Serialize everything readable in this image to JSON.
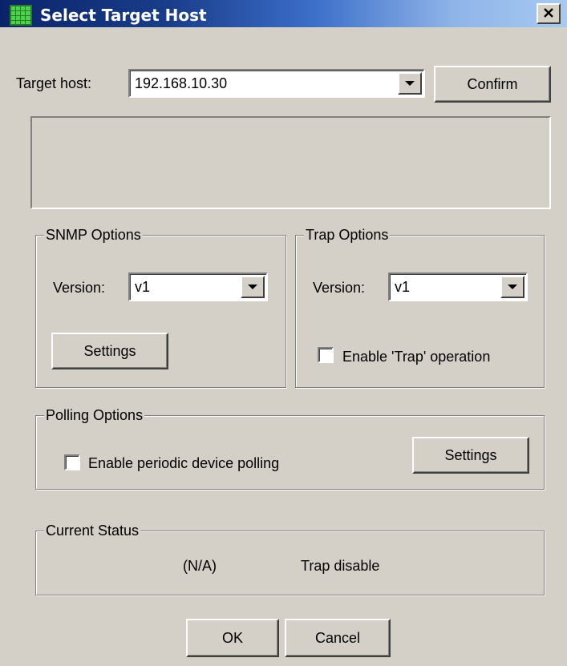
{
  "window": {
    "title": "Select Target Host",
    "icon": "grid-app-icon",
    "close_icon": "close-icon"
  },
  "target": {
    "label": "Target host:",
    "value": "192.168.10.30",
    "confirm_label": "Confirm"
  },
  "snmp": {
    "legend": "SNMP Options",
    "version_label": "Version:",
    "version_value": "v1",
    "settings_label": "Settings"
  },
  "trap": {
    "legend": "Trap Options",
    "version_label": "Version:",
    "version_value": "v1",
    "enable_label": "Enable 'Trap' operation",
    "enable_checked": false
  },
  "polling": {
    "legend": "Polling Options",
    "enable_label": "Enable periodic device polling",
    "enable_checked": false,
    "settings_label": "Settings"
  },
  "status": {
    "legend": "Current Status",
    "value1": "(N/A)",
    "value2": "Trap disable"
  },
  "footer": {
    "ok_label": "OK",
    "cancel_label": "Cancel"
  }
}
